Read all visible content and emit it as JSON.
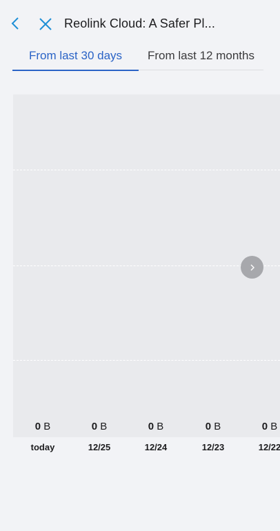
{
  "header": {
    "title": "Reolink Cloud: A Safer Pl...",
    "back_icon": "chevron-left-icon",
    "close_icon": "close-icon"
  },
  "tabs": [
    {
      "label": "From last 30 days",
      "active": true
    },
    {
      "label": "From last 12 months",
      "active": false
    }
  ],
  "colors": {
    "accent": "#2a63c6",
    "icon": "#1e8fd6",
    "background": "#f2f3f6",
    "chart_background": "#e9eaed"
  },
  "chart": {
    "next_icon": "chevron-right-icon",
    "columns": [
      {
        "label": "today",
        "value": "0",
        "unit": "B"
      },
      {
        "label": "12/25",
        "value": "0",
        "unit": "B"
      },
      {
        "label": "12/24",
        "value": "0",
        "unit": "B"
      },
      {
        "label": "12/23",
        "value": "0",
        "unit": "B"
      },
      {
        "label": "12/22",
        "value": "0",
        "unit": "B"
      }
    ]
  }
}
